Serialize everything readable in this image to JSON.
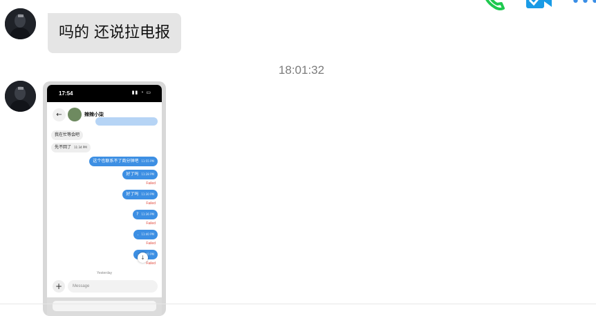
{
  "header": {
    "phone_icon": "phone-icon",
    "video_icon": "video-icon",
    "more_icon": "more-icon",
    "accent_green": "#1fc94f",
    "accent_blue": "#3a8ee6"
  },
  "messages": [
    {
      "text": "吗的 还说拉电报"
    }
  ],
  "timestamp": "18:01:32",
  "screenshot": {
    "status_time": "17:54",
    "contact_name": "辣辣小柒",
    "incoming": [
      {
        "text": "我在忙等会吧"
      },
      {
        "text": "先不回了",
        "time": "11:34 PM"
      }
    ],
    "outgoing": [
      {
        "text": "这个也联系不了商分钟吧",
        "time": "11:55 PM"
      },
      {
        "text": "好了吗",
        "time": "11:28 PM",
        "status": "Failed"
      },
      {
        "text": "好了吗",
        "time": "11:30 PM",
        "status": "Failed"
      },
      {
        "text": "?",
        "time": "11:36 PM",
        "status": "Failed"
      },
      {
        "text": ".",
        "time": "11:40 PM",
        "status": "Failed"
      },
      {
        "text": ".",
        "time": "11:40 PM",
        "status": "Failed"
      }
    ],
    "divider": "Yesterday",
    "input_placeholder": "Message"
  }
}
